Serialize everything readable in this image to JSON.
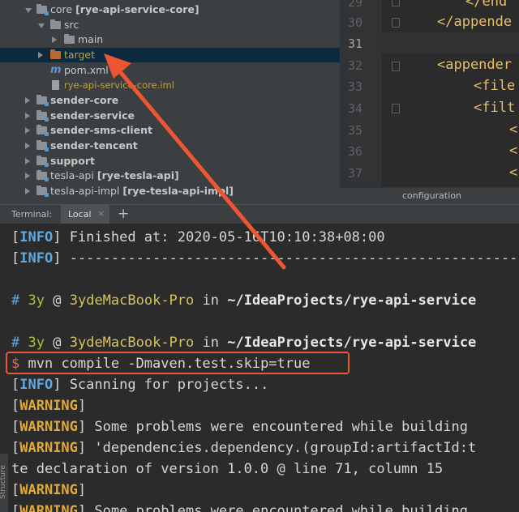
{
  "project_tree": {
    "items": [
      {
        "name": "core",
        "module": "[rye-api-service-core]"
      },
      {
        "name": "src"
      },
      {
        "name": "main"
      },
      {
        "name": "target"
      },
      {
        "name": "pom.xml"
      },
      {
        "name": "rye-api-service-core.iml"
      },
      {
        "name": "sender-core"
      },
      {
        "name": "sender-service"
      },
      {
        "name": "sender-sms-client"
      },
      {
        "name": "sender-tencent"
      },
      {
        "name": "support"
      },
      {
        "name": "tesla-api",
        "module": "[rye-tesla-api]"
      },
      {
        "name": "tesla-api-impl",
        "module": "[rye-tesla-api-impl]"
      }
    ]
  },
  "editor": {
    "line_numbers": [
      "29",
      "30",
      "31",
      "32",
      "33",
      "34",
      "35",
      "36",
      "37"
    ],
    "current_line": "31",
    "code_lines": [
      "</end",
      "</appende",
      "",
      "<appender",
      "<file",
      "<filt",
      "<",
      "<",
      "<"
    ],
    "breadcrumb": "configuration"
  },
  "terminal_bar": {
    "title": "Terminal:",
    "tab_label": "Local",
    "close_glyph": "×",
    "add_glyph": "+"
  },
  "terminal": {
    "line1": {
      "bracket_open": "[",
      "level": "INFO",
      "bracket_close": "]",
      "text": " Finished at: 2020-05-16T10:10:38+08:00"
    },
    "line2": {
      "bracket_open": "[",
      "level": "INFO",
      "bracket_close": "]",
      "text": " -------------------------------------------------------------------"
    },
    "prompt1": {
      "hash": "#",
      "user": "3y",
      "at": "@",
      "host": "3ydeMacBook-Pro",
      "in": "in",
      "path": "~/IdeaProjects/rye-api-service"
    },
    "prompt2": {
      "hash": "#",
      "user": "3y",
      "at": "@",
      "host": "3ydeMacBook-Pro",
      "in": "in",
      "path": "~/IdeaProjects/rye-api-service"
    },
    "command": {
      "dollar": "$",
      "text": "mvn compile -Dmaven.test.skip=true"
    },
    "line3": {
      "bracket_open": "[",
      "level": "INFO",
      "bracket_close": "]",
      "text": " Scanning for projects..."
    },
    "line4": {
      "bracket_open": "[",
      "level": "WARNING",
      "bracket_close": "]",
      "text": ""
    },
    "line5": {
      "bracket_open": "[",
      "level": "WARNING",
      "bracket_close": "]",
      "text": " Some problems were encountered while building"
    },
    "line6": {
      "bracket_open": "[",
      "level": "WARNING",
      "bracket_close": "]",
      "text": " 'dependencies.dependency.(groupId:artifactId:t"
    },
    "line7": {
      "text": "te declaration of version 1.0.0 @ line 71, column 15"
    },
    "line8": {
      "bracket_open": "[",
      "level": "WARNING",
      "bracket_close": "]",
      "text": ""
    },
    "line9": {
      "bracket_open": "[",
      "level": "WARNING",
      "bracket_close": "]",
      "text": " Some problems were encountered while building"
    }
  },
  "side_panel_label": "Structure",
  "annotation": {
    "color": "#ee5533"
  }
}
